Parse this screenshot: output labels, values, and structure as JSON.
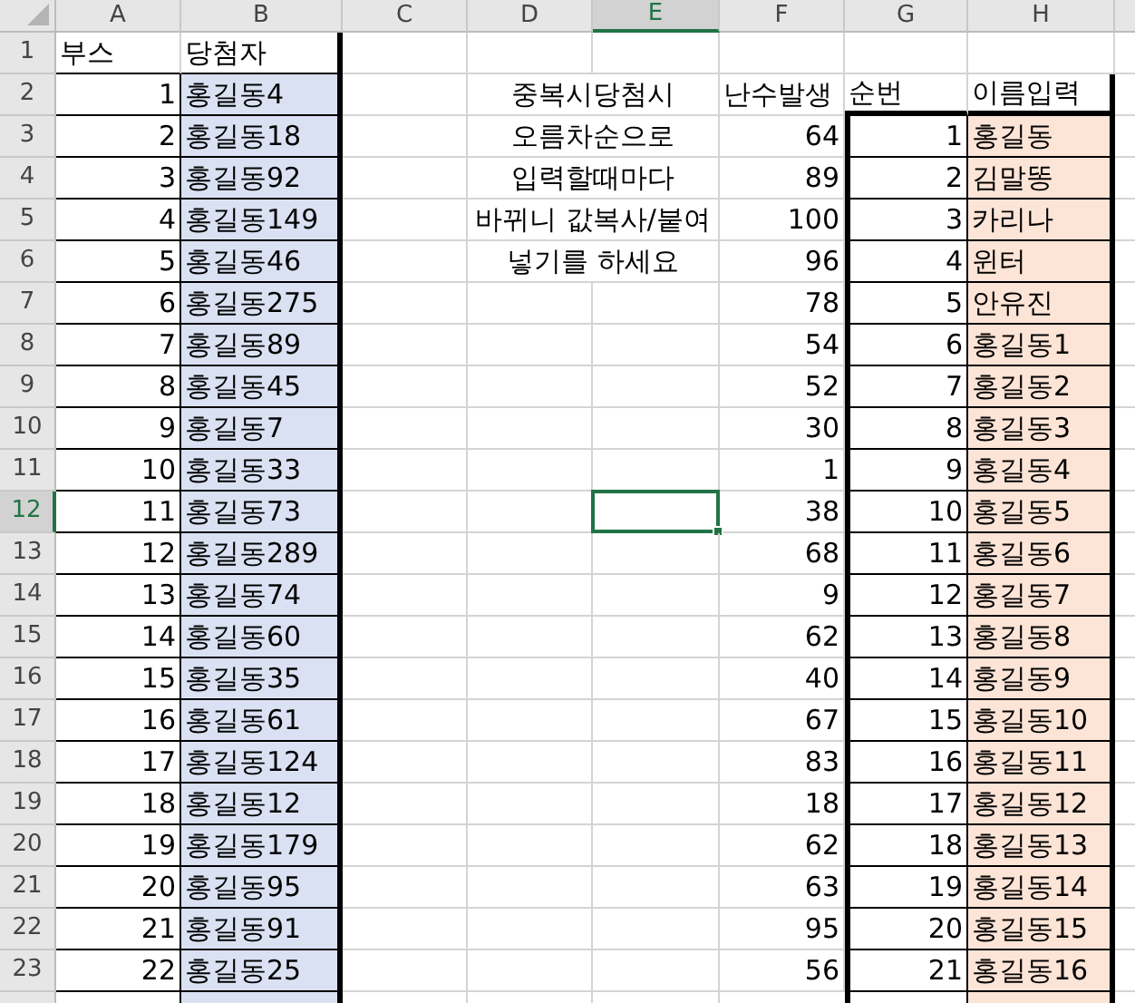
{
  "columns": [
    {
      "label": "A",
      "selected": false
    },
    {
      "label": "B",
      "selected": false
    },
    {
      "label": "C",
      "selected": false
    },
    {
      "label": "D",
      "selected": false
    },
    {
      "label": "E",
      "selected": true
    },
    {
      "label": "F",
      "selected": false
    },
    {
      "label": "G",
      "selected": false
    },
    {
      "label": "H",
      "selected": false
    }
  ],
  "rows": [
    {
      "header": "1",
      "selected": false,
      "a": {
        "text": "부스",
        "kind": "label"
      },
      "b": {
        "text": "당첨자",
        "kind": "label"
      }
    },
    {
      "header": "2",
      "selected": false,
      "a": {
        "text": "1",
        "kind": "value"
      },
      "b": {
        "text": "홍길동4",
        "kind": "value"
      },
      "d_e": "중복시당첨시",
      "f": {
        "text": "난수발생",
        "kind": "label"
      },
      "g": {
        "text": "순번",
        "kind": "label"
      },
      "h": {
        "text": "이름입력",
        "kind": "label"
      }
    },
    {
      "header": "3",
      "selected": false,
      "a": {
        "text": "2",
        "kind": "value"
      },
      "b": {
        "text": "홍길동18",
        "kind": "value"
      },
      "d_e": "오름차순으로",
      "f": {
        "text": "64",
        "kind": "value"
      },
      "g": {
        "text": "1",
        "kind": "value"
      },
      "h": {
        "text": "홍길동",
        "kind": "value"
      }
    },
    {
      "header": "4",
      "selected": false,
      "a": {
        "text": "3",
        "kind": "value"
      },
      "b": {
        "text": "홍길동92",
        "kind": "value"
      },
      "d_e": "입력할때마다",
      "f": {
        "text": "89",
        "kind": "value"
      },
      "g": {
        "text": "2",
        "kind": "value"
      },
      "h": {
        "text": "김말똥",
        "kind": "value"
      }
    },
    {
      "header": "5",
      "selected": false,
      "a": {
        "text": "4",
        "kind": "value"
      },
      "b": {
        "text": "홍길동149",
        "kind": "value"
      },
      "d_e": "바뀌니 값복사/붙여",
      "f": {
        "text": "100",
        "kind": "value"
      },
      "g": {
        "text": "3",
        "kind": "value"
      },
      "h": {
        "text": "카리나",
        "kind": "value"
      }
    },
    {
      "header": "6",
      "selected": false,
      "a": {
        "text": "5",
        "kind": "value"
      },
      "b": {
        "text": "홍길동46",
        "kind": "value"
      },
      "d_e": "넣기를 하세요",
      "f": {
        "text": "96",
        "kind": "value"
      },
      "g": {
        "text": "4",
        "kind": "value"
      },
      "h": {
        "text": "윈터",
        "kind": "value"
      }
    },
    {
      "header": "7",
      "selected": false,
      "a": {
        "text": "6",
        "kind": "value"
      },
      "b": {
        "text": "홍길동275",
        "kind": "value"
      },
      "f": {
        "text": "78",
        "kind": "value"
      },
      "g": {
        "text": "5",
        "kind": "value"
      },
      "h": {
        "text": "안유진",
        "kind": "value"
      }
    },
    {
      "header": "8",
      "selected": false,
      "a": {
        "text": "7",
        "kind": "value"
      },
      "b": {
        "text": "홍길동89",
        "kind": "value"
      },
      "f": {
        "text": "54",
        "kind": "value"
      },
      "g": {
        "text": "6",
        "kind": "value"
      },
      "h": {
        "text": "홍길동1",
        "kind": "value"
      }
    },
    {
      "header": "9",
      "selected": false,
      "a": {
        "text": "8",
        "kind": "value"
      },
      "b": {
        "text": "홍길동45",
        "kind": "value"
      },
      "f": {
        "text": "52",
        "kind": "value"
      },
      "g": {
        "text": "7",
        "kind": "value"
      },
      "h": {
        "text": "홍길동2",
        "kind": "value"
      }
    },
    {
      "header": "10",
      "selected": false,
      "a": {
        "text": "9",
        "kind": "value"
      },
      "b": {
        "text": "홍길동7",
        "kind": "value"
      },
      "f": {
        "text": "30",
        "kind": "value"
      },
      "g": {
        "text": "8",
        "kind": "value"
      },
      "h": {
        "text": "홍길동3",
        "kind": "value"
      }
    },
    {
      "header": "11",
      "selected": false,
      "a": {
        "text": "10",
        "kind": "value"
      },
      "b": {
        "text": "홍길동33",
        "kind": "value"
      },
      "f": {
        "text": "1",
        "kind": "value"
      },
      "g": {
        "text": "9",
        "kind": "value"
      },
      "h": {
        "text": "홍길동4",
        "kind": "value"
      }
    },
    {
      "header": "12",
      "selected": true,
      "a": {
        "text": "11",
        "kind": "value"
      },
      "b": {
        "text": "홍길동73",
        "kind": "value"
      },
      "f": {
        "text": "38",
        "kind": "value"
      },
      "g": {
        "text": "10",
        "kind": "value"
      },
      "h": {
        "text": "홍길동5",
        "kind": "value"
      }
    },
    {
      "header": "13",
      "selected": false,
      "a": {
        "text": "12",
        "kind": "value"
      },
      "b": {
        "text": "홍길동289",
        "kind": "value"
      },
      "f": {
        "text": "68",
        "kind": "value"
      },
      "g": {
        "text": "11",
        "kind": "value"
      },
      "h": {
        "text": "홍길동6",
        "kind": "value"
      }
    },
    {
      "header": "14",
      "selected": false,
      "a": {
        "text": "13",
        "kind": "value"
      },
      "b": {
        "text": "홍길동74",
        "kind": "value"
      },
      "f": {
        "text": "9",
        "kind": "value"
      },
      "g": {
        "text": "12",
        "kind": "value"
      },
      "h": {
        "text": "홍길동7",
        "kind": "value"
      }
    },
    {
      "header": "15",
      "selected": false,
      "a": {
        "text": "14",
        "kind": "value"
      },
      "b": {
        "text": "홍길동60",
        "kind": "value"
      },
      "f": {
        "text": "62",
        "kind": "value"
      },
      "g": {
        "text": "13",
        "kind": "value"
      },
      "h": {
        "text": "홍길동8",
        "kind": "value"
      }
    },
    {
      "header": "16",
      "selected": false,
      "a": {
        "text": "15",
        "kind": "value"
      },
      "b": {
        "text": "홍길동35",
        "kind": "value"
      },
      "f": {
        "text": "40",
        "kind": "value"
      },
      "g": {
        "text": "14",
        "kind": "value"
      },
      "h": {
        "text": "홍길동9",
        "kind": "value"
      }
    },
    {
      "header": "17",
      "selected": false,
      "a": {
        "text": "16",
        "kind": "value"
      },
      "b": {
        "text": "홍길동61",
        "kind": "value"
      },
      "f": {
        "text": "67",
        "kind": "value"
      },
      "g": {
        "text": "15",
        "kind": "value"
      },
      "h": {
        "text": "홍길동10",
        "kind": "value"
      }
    },
    {
      "header": "18",
      "selected": false,
      "a": {
        "text": "17",
        "kind": "value"
      },
      "b": {
        "text": "홍길동124",
        "kind": "value"
      },
      "f": {
        "text": "83",
        "kind": "value"
      },
      "g": {
        "text": "16",
        "kind": "value"
      },
      "h": {
        "text": "홍길동11",
        "kind": "value"
      }
    },
    {
      "header": "19",
      "selected": false,
      "a": {
        "text": "18",
        "kind": "value"
      },
      "b": {
        "text": "홍길동12",
        "kind": "value"
      },
      "f": {
        "text": "18",
        "kind": "value"
      },
      "g": {
        "text": "17",
        "kind": "value"
      },
      "h": {
        "text": "홍길동12",
        "kind": "value"
      }
    },
    {
      "header": "20",
      "selected": false,
      "a": {
        "text": "19",
        "kind": "value"
      },
      "b": {
        "text": "홍길동179",
        "kind": "value"
      },
      "f": {
        "text": "62",
        "kind": "value"
      },
      "g": {
        "text": "18",
        "kind": "value"
      },
      "h": {
        "text": "홍길동13",
        "kind": "value"
      }
    },
    {
      "header": "21",
      "selected": false,
      "a": {
        "text": "20",
        "kind": "value"
      },
      "b": {
        "text": "홍길동95",
        "kind": "value"
      },
      "f": {
        "text": "63",
        "kind": "value"
      },
      "g": {
        "text": "19",
        "kind": "value"
      },
      "h": {
        "text": "홍길동14",
        "kind": "value"
      }
    },
    {
      "header": "22",
      "selected": false,
      "a": {
        "text": "21",
        "kind": "value"
      },
      "b": {
        "text": "홍길동91",
        "kind": "value"
      },
      "f": {
        "text": "95",
        "kind": "value"
      },
      "g": {
        "text": "20",
        "kind": "value"
      },
      "h": {
        "text": "홍길동15",
        "kind": "value"
      }
    },
    {
      "header": "23",
      "selected": false,
      "a": {
        "text": "22",
        "kind": "value"
      },
      "b": {
        "text": "홍길동25",
        "kind": "value"
      },
      "f": {
        "text": "56",
        "kind": "value"
      },
      "g": {
        "text": "21",
        "kind": "value"
      },
      "h": {
        "text": "홍길동16",
        "kind": "value"
      }
    }
  ]
}
